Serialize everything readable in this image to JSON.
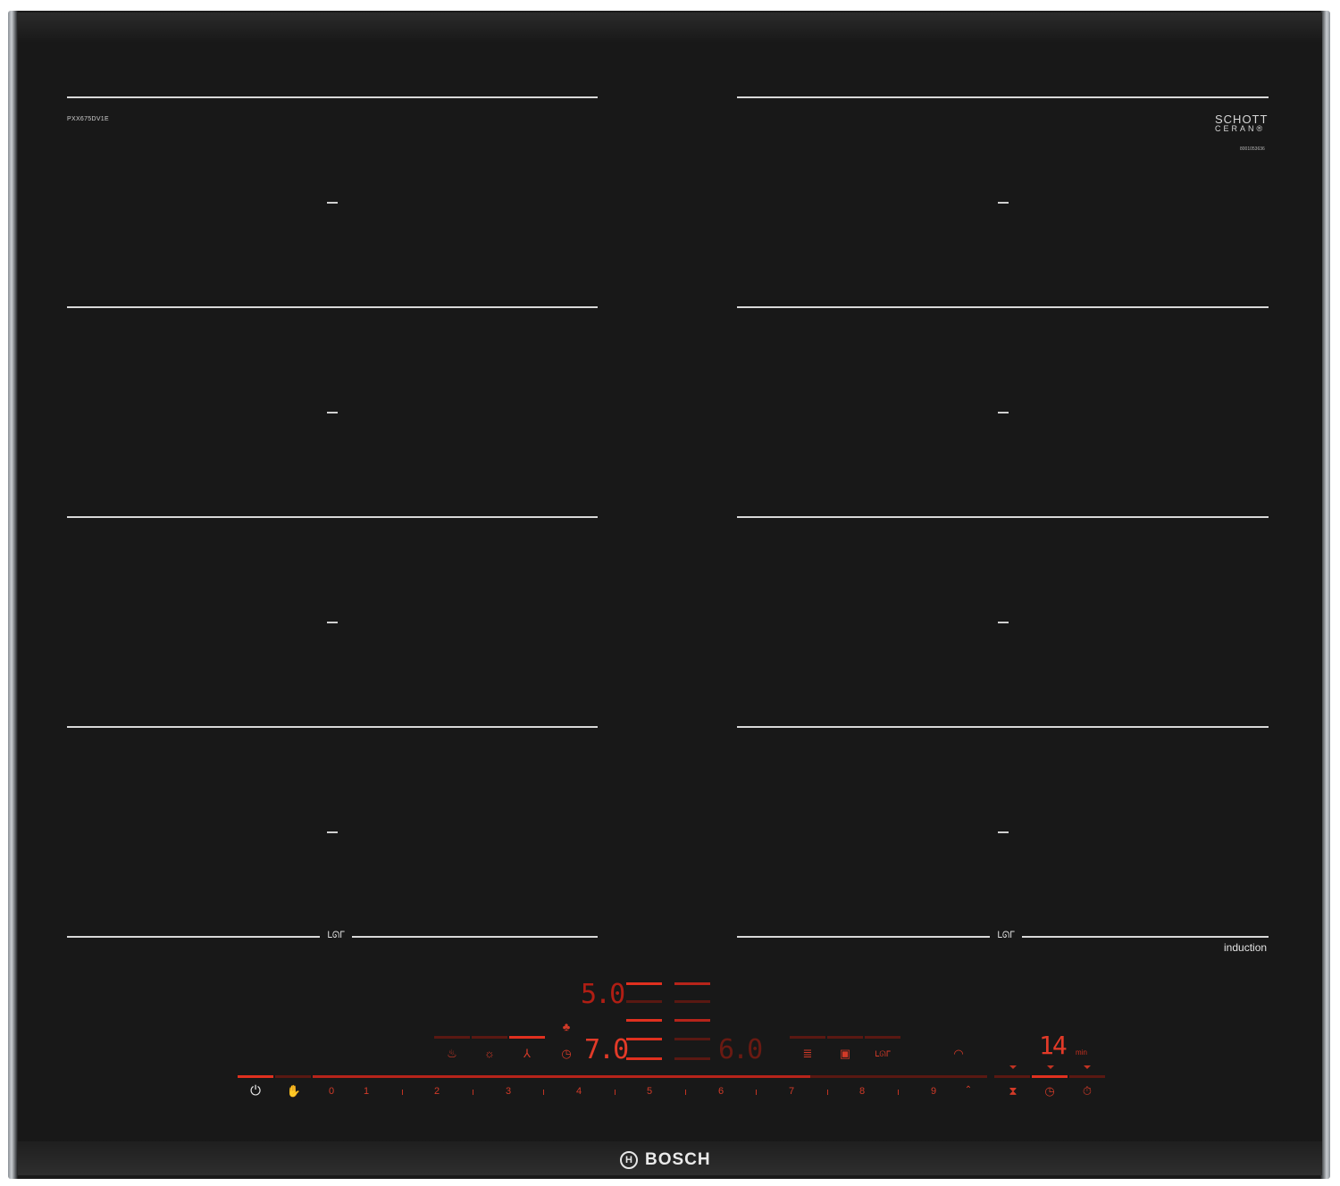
{
  "hob": {
    "model": "PXX675DV1E",
    "schott_line1": "SCHOTT",
    "schott_line2": "CERAN®",
    "serial": "8001053636",
    "induction_label": "induction",
    "flex_logo": "ᒪᘏᒥ",
    "brand": "BOSCH",
    "brand_mark": "H"
  },
  "displays": {
    "upper_left": "5.0",
    "middle_left": "7.0",
    "middle_right": "6.0",
    "timer": "14",
    "timer_unit": "min"
  },
  "slider": {
    "numbers": [
      "0",
      "1",
      "2",
      "3",
      "4",
      "5",
      "6",
      "7",
      "8",
      "9"
    ]
  },
  "icons": {
    "power": "power-icon",
    "child_lock": "child-lock-icon",
    "fry": "fry-sensor-icon",
    "hood": "hood-control-icon",
    "boost": "boost-icon",
    "timer": "timer-icon",
    "kitchen_timer": "kitchen-timer-icon",
    "stopwatch": "stopwatch-icon",
    "wifi": "wifi-icon",
    "fan": "fan-icon",
    "light": "light-icon",
    "clock": "clock-icon",
    "list": "list-icon",
    "picture": "picture-icon",
    "flex": "flex-zone-icon"
  },
  "colors": {
    "glass": "#181818",
    "display_red": "#e23a28",
    "dim_red": "#5a1812",
    "zone_line": "#d8d8d8"
  }
}
